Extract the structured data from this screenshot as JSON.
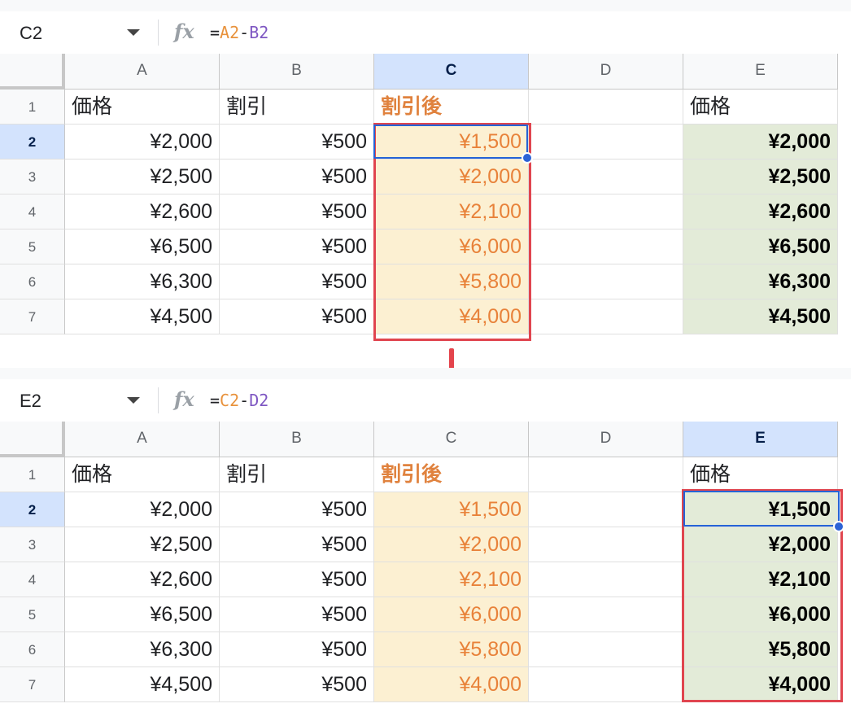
{
  "panels": [
    {
      "namebox": "C2",
      "formula": {
        "eq": "=",
        "ref1": "A2",
        "op": "-",
        "ref2": "B2"
      },
      "columns": [
        "A",
        "B",
        "C",
        "D",
        "E"
      ],
      "selected_column": "C",
      "rows": [
        "1",
        "2",
        "3",
        "4",
        "5",
        "6",
        "7"
      ],
      "selected_row": "2",
      "header_row": {
        "A": "価格",
        "B": "割引",
        "C": "割引後",
        "D": "",
        "E": "価格"
      },
      "data": [
        {
          "A": "¥2,000",
          "B": "¥500",
          "C": "¥1,500",
          "E": "¥2,000"
        },
        {
          "A": "¥2,500",
          "B": "¥500",
          "C": "¥2,000",
          "E": "¥2,500"
        },
        {
          "A": "¥2,600",
          "B": "¥500",
          "C": "¥2,100",
          "E": "¥2,600"
        },
        {
          "A": "¥6,500",
          "B": "¥500",
          "C": "¥6,000",
          "E": "¥6,500"
        },
        {
          "A": "¥6,300",
          "B": "¥500",
          "C": "¥5,800",
          "E": "¥6,300"
        },
        {
          "A": "¥4,500",
          "B": "¥500",
          "C": "¥4,000",
          "E": "¥4,500"
        }
      ]
    },
    {
      "namebox": "E2",
      "formula": {
        "eq": "=",
        "ref1": "C2",
        "op": "-",
        "ref2": "D2"
      },
      "columns": [
        "A",
        "B",
        "C",
        "D",
        "E"
      ],
      "selected_column": "E",
      "rows": [
        "1",
        "2",
        "3",
        "4",
        "5",
        "6",
        "7"
      ],
      "selected_row": "2",
      "header_row": {
        "A": "価格",
        "B": "割引",
        "C": "割引後",
        "D": "",
        "E": "価格"
      },
      "data": [
        {
          "A": "¥2,000",
          "B": "¥500",
          "C": "¥1,500",
          "E": "¥1,500"
        },
        {
          "A": "¥2,500",
          "B": "¥500",
          "C": "¥2,000",
          "E": "¥2,000"
        },
        {
          "A": "¥2,600",
          "B": "¥500",
          "C": "¥2,100",
          "E": "¥2,100"
        },
        {
          "A": "¥6,500",
          "B": "¥500",
          "C": "¥6,000",
          "E": "¥6,000"
        },
        {
          "A": "¥6,300",
          "B": "¥500",
          "C": "¥5,800",
          "E": "¥5,800"
        },
        {
          "A": "¥4,500",
          "B": "¥500",
          "C": "¥4,000",
          "E": "¥4,000"
        }
      ]
    }
  ],
  "colors": {
    "highlight_red": "#e0454f",
    "selection_blue": "#2563d6",
    "column_c_fill": "#fcf0d2",
    "column_e_fill": "#e3ebd8",
    "orange_text": "#e8823a"
  },
  "icons": {
    "formula": "fx-icon",
    "dropdown": "chevron-down-icon"
  }
}
